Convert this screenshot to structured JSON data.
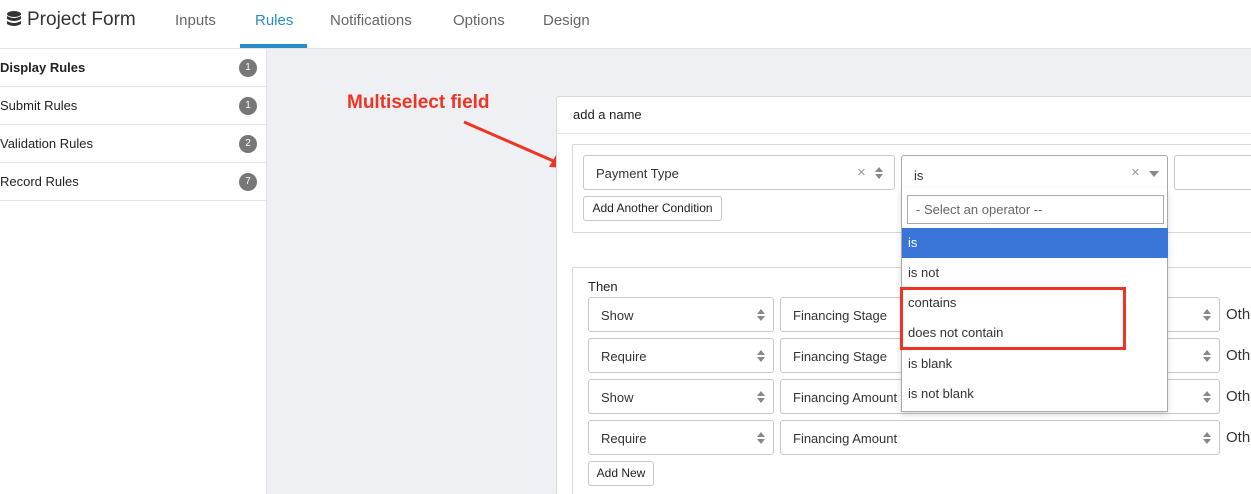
{
  "app": {
    "title": "Project Form",
    "logo_icon": "database-icon"
  },
  "tabs": [
    {
      "label": "Inputs",
      "active": false
    },
    {
      "label": "Rules",
      "active": true
    },
    {
      "label": "Notifications",
      "active": false
    },
    {
      "label": "Options",
      "active": false
    },
    {
      "label": "Design",
      "active": false
    }
  ],
  "sidebar": {
    "items": [
      {
        "label": "Display Rules",
        "count": "1",
        "active": true
      },
      {
        "label": "Submit Rules",
        "count": "1",
        "active": false
      },
      {
        "label": "Validation Rules",
        "count": "2",
        "active": false
      },
      {
        "label": "Record Rules",
        "count": "7",
        "active": false
      }
    ]
  },
  "annotation": {
    "text": "Multiselect field",
    "color": "#ee3524"
  },
  "rule": {
    "name": "add a name",
    "condition": {
      "field": "Payment Type",
      "operator": "is",
      "add_condition_label": "Add Another Condition"
    },
    "operator_dropdown": {
      "search_placeholder": "- Select an operator --",
      "options": [
        "is",
        "is not",
        "contains",
        "does not contain",
        "is blank",
        "is not blank"
      ],
      "highlighted": "is"
    },
    "then": {
      "label": "Then",
      "actions": [
        {
          "action": "Show",
          "target": "Financing Stage",
          "other": "Oth"
        },
        {
          "action": "Require",
          "target": "Financing Stage",
          "other": "Oth"
        },
        {
          "action": "Show",
          "target": "Financing Amount",
          "other": "Oth"
        },
        {
          "action": "Require",
          "target": "Financing Amount",
          "other": "Oth"
        }
      ],
      "add_new_label": "Add New"
    }
  },
  "colors": {
    "accent": "#2a8dc7",
    "highlight": "#3875d7",
    "annotation": "#ee3524"
  }
}
